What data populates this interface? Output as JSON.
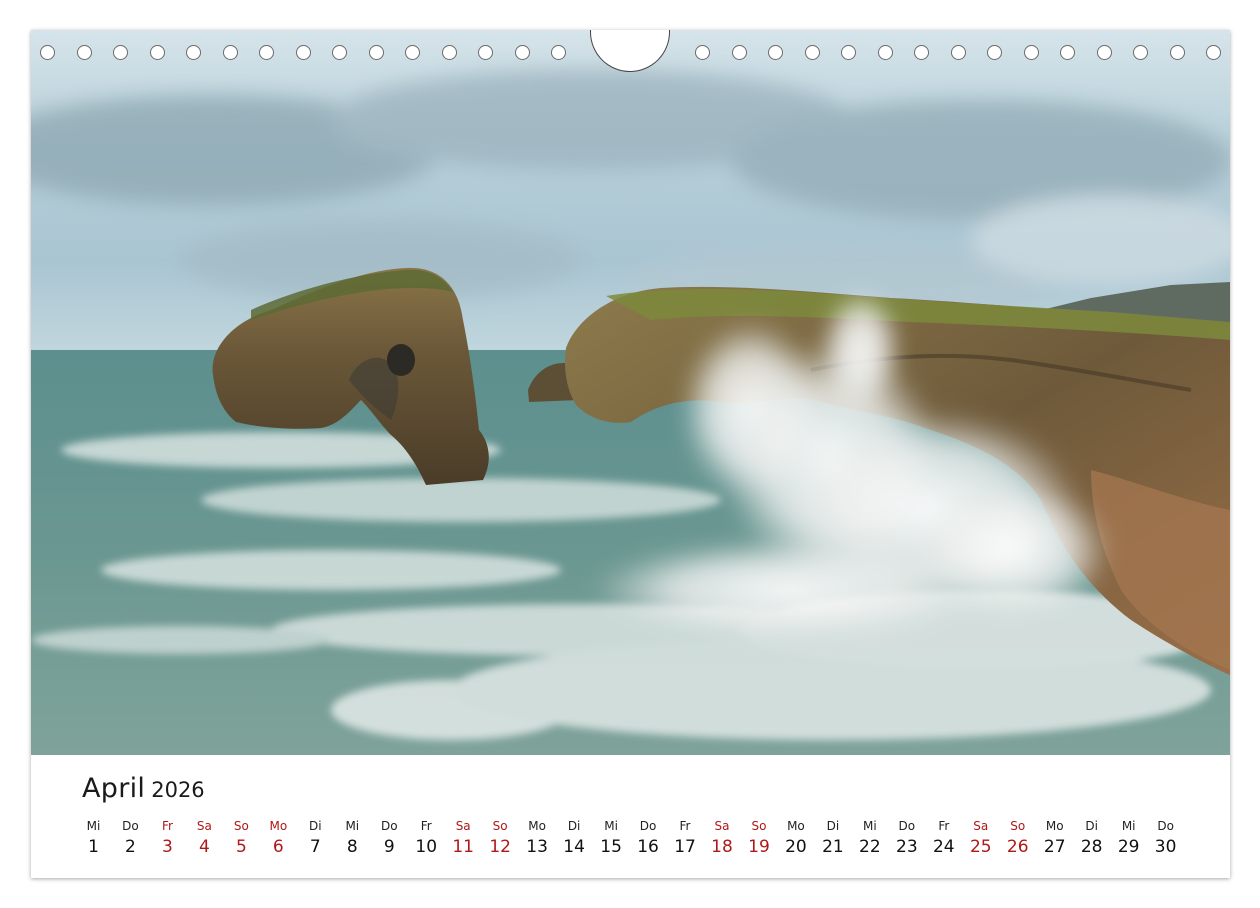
{
  "calendar": {
    "month": "April",
    "year": "2026",
    "weekend_color": "#b01818",
    "days": [
      {
        "wd": "Mi",
        "d": "1",
        "we": false
      },
      {
        "wd": "Do",
        "d": "2",
        "we": false
      },
      {
        "wd": "Fr",
        "d": "3",
        "we": true
      },
      {
        "wd": "Sa",
        "d": "4",
        "we": true
      },
      {
        "wd": "So",
        "d": "5",
        "we": true
      },
      {
        "wd": "Mo",
        "d": "6",
        "we": true
      },
      {
        "wd": "Di",
        "d": "7",
        "we": false
      },
      {
        "wd": "Mi",
        "d": "8",
        "we": false
      },
      {
        "wd": "Do",
        "d": "9",
        "we": false
      },
      {
        "wd": "Fr",
        "d": "10",
        "we": false
      },
      {
        "wd": "Sa",
        "d": "11",
        "we": true
      },
      {
        "wd": "So",
        "d": "12",
        "we": true
      },
      {
        "wd": "Mo",
        "d": "13",
        "we": false
      },
      {
        "wd": "Di",
        "d": "14",
        "we": false
      },
      {
        "wd": "Mi",
        "d": "15",
        "we": false
      },
      {
        "wd": "Do",
        "d": "16",
        "we": false
      },
      {
        "wd": "Fr",
        "d": "17",
        "we": false
      },
      {
        "wd": "Sa",
        "d": "18",
        "we": true
      },
      {
        "wd": "So",
        "d": "19",
        "we": true
      },
      {
        "wd": "Mo",
        "d": "20",
        "we": false
      },
      {
        "wd": "Di",
        "d": "21",
        "we": false
      },
      {
        "wd": "Mi",
        "d": "22",
        "we": false
      },
      {
        "wd": "Do",
        "d": "23",
        "we": false
      },
      {
        "wd": "Fr",
        "d": "24",
        "we": false
      },
      {
        "wd": "Sa",
        "d": "25",
        "we": true
      },
      {
        "wd": "So",
        "d": "26",
        "we": true
      },
      {
        "wd": "Mo",
        "d": "27",
        "we": false
      },
      {
        "wd": "Di",
        "d": "28",
        "we": false
      },
      {
        "wd": "Mi",
        "d": "29",
        "we": false
      },
      {
        "wd": "Do",
        "d": "30",
        "we": false
      }
    ]
  },
  "photo": {
    "subject": "sea-arch-coast-waves",
    "sky_color": "#b9d0da",
    "sea_color": "#5f8e8a",
    "rock_color": "#7a6440",
    "foam_color": "#f2f1ef"
  },
  "binding": {
    "hole_count": 32,
    "hanger": "hanger-cutout"
  }
}
